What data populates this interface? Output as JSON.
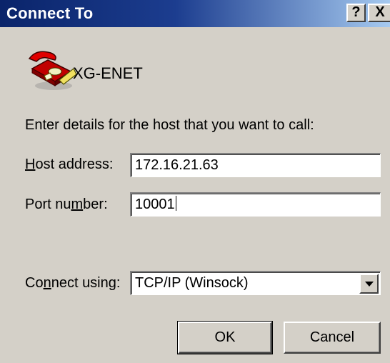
{
  "window": {
    "title": "Connect To",
    "help_label": "?",
    "close_label": "X"
  },
  "connection": {
    "name": "XG-ENET",
    "icon": "phone-icon"
  },
  "prompt": "Enter details for the host that you want to call:",
  "host_address": {
    "label_mnemonic": "H",
    "label_rest": "ost address:",
    "value": "172.16.21.63"
  },
  "port_number": {
    "label_pre": "Port nu",
    "label_mnemonic": "m",
    "label_post": "ber:",
    "value": "10001"
  },
  "connect_using": {
    "label_pre": "Co",
    "label_mnemonic": "n",
    "label_post": "nect using:",
    "selected": "TCP/IP (Winsock)"
  },
  "buttons": {
    "ok": "OK",
    "cancel": "Cancel"
  },
  "colors": {
    "title_bar_start": "#0a246a",
    "title_bar_end": "#a6caf0",
    "dialog_face": "#d4d0c8"
  }
}
